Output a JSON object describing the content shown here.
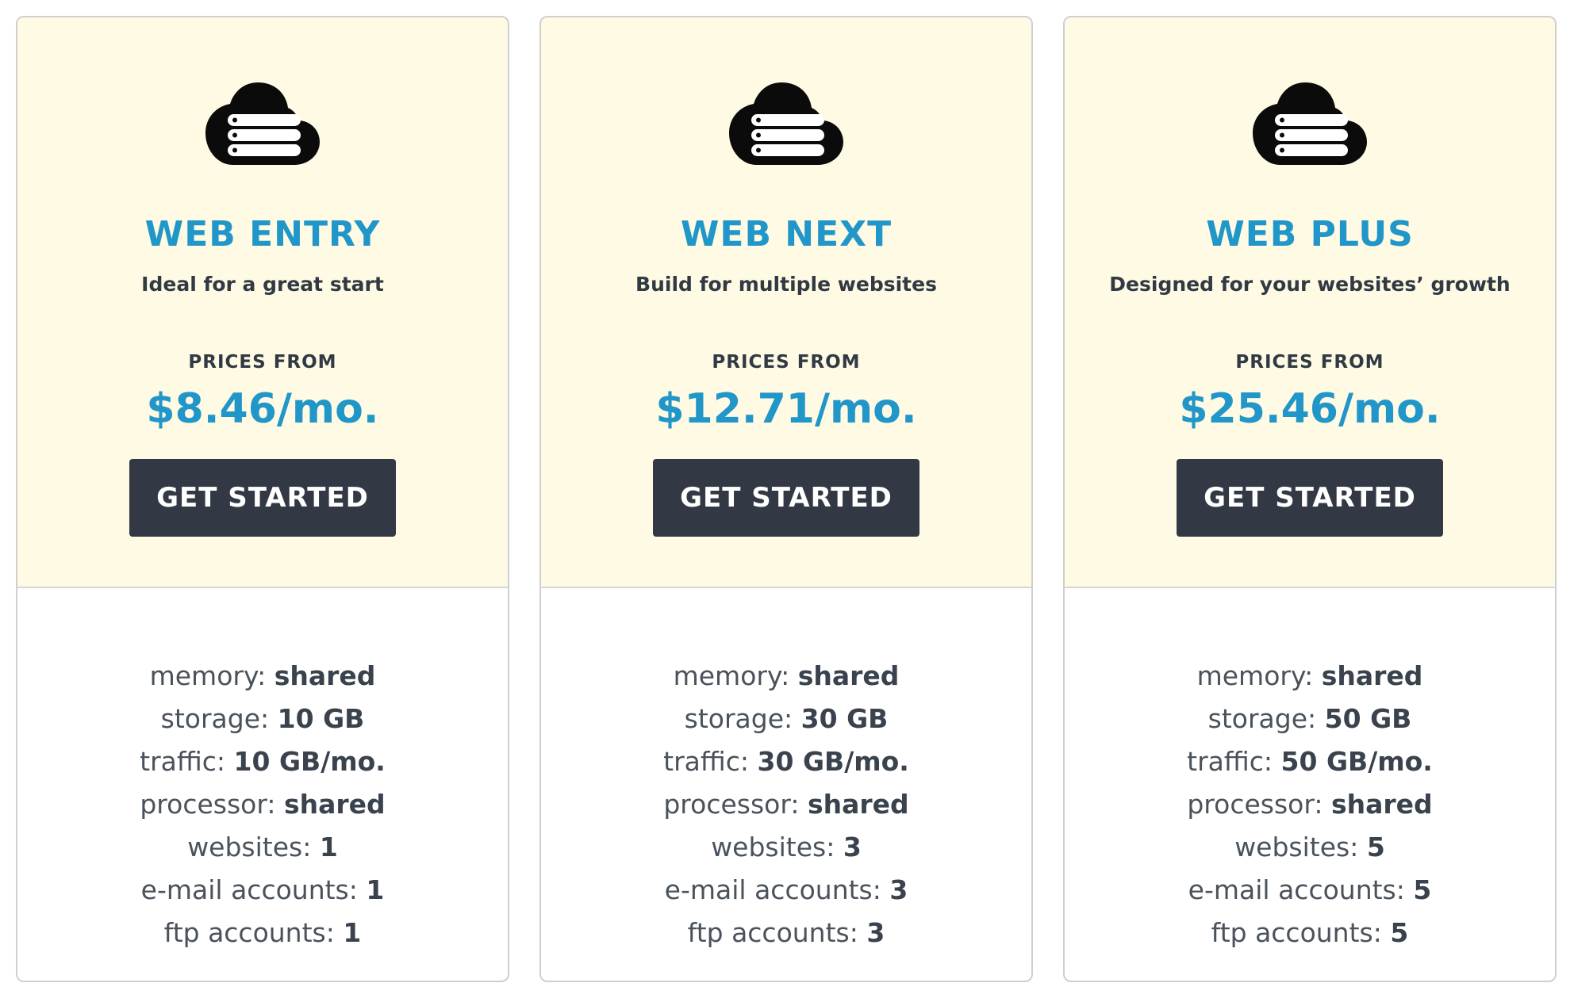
{
  "plans": [
    {
      "icon": "cloud-server-icon",
      "name": "WEB ENTRY",
      "tagline": "Ideal for a great start",
      "prices_label": "PRICES FROM",
      "price": "$8.46/mo.",
      "cta_label": "GET STARTED",
      "specs": [
        {
          "label": "memory:",
          "value": "shared"
        },
        {
          "label": "storage:",
          "value": "10 GB"
        },
        {
          "label": "traffic:",
          "value": "10 GB/mo."
        },
        {
          "label": "processor:",
          "value": "shared"
        },
        {
          "label": "websites:",
          "value": "1"
        },
        {
          "label": "e-mail accounts:",
          "value": "1"
        },
        {
          "label": "ftp accounts:",
          "value": "1"
        }
      ]
    },
    {
      "icon": "cloud-server-icon",
      "name": "WEB NEXT",
      "tagline": "Build for multiple websites",
      "prices_label": "PRICES FROM",
      "price": "$12.71/mo.",
      "cta_label": "GET STARTED",
      "specs": [
        {
          "label": "memory:",
          "value": "shared"
        },
        {
          "label": "storage:",
          "value": "30 GB"
        },
        {
          "label": "traffic:",
          "value": "30 GB/mo."
        },
        {
          "label": "processor:",
          "value": "shared"
        },
        {
          "label": "websites:",
          "value": "3"
        },
        {
          "label": "e-mail accounts:",
          "value": "3"
        },
        {
          "label": "ftp accounts:",
          "value": "3"
        }
      ]
    },
    {
      "icon": "cloud-server-icon",
      "name": "WEB PLUS",
      "tagline": "Designed for your websites’ growth",
      "prices_label": "PRICES FROM",
      "price": "$25.46/mo.",
      "cta_label": "GET STARTED",
      "specs": [
        {
          "label": "memory:",
          "value": "shared"
        },
        {
          "label": "storage:",
          "value": "50 GB"
        },
        {
          "label": "traffic:",
          "value": "50 GB/mo."
        },
        {
          "label": "processor:",
          "value": "shared"
        },
        {
          "label": "websites:",
          "value": "5"
        },
        {
          "label": "e-mail accounts:",
          "value": "5"
        },
        {
          "label": "ftp accounts:",
          "value": "5"
        }
      ]
    }
  ],
  "colors": {
    "accent": "#2196c9",
    "header_bg": "#fefae3",
    "button_bg": "#323944",
    "text": "#3a424d"
  }
}
